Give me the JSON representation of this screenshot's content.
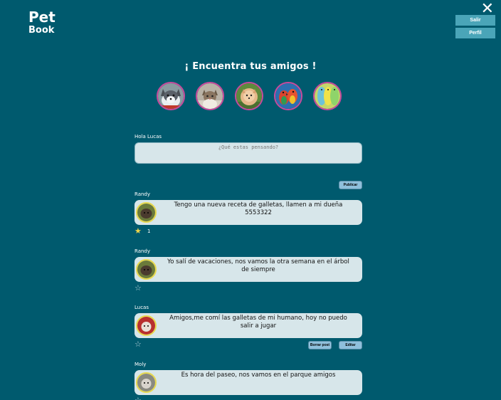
{
  "app": {
    "logo_line1": "Pet",
    "logo_line2": "Book"
  },
  "header": {
    "close_glyph": "✕",
    "logout_label": "Salir",
    "profile_label": "Perfil"
  },
  "friends": {
    "heading": "¡ Encuentra tus amigos !",
    "avatars": [
      "husky",
      "cat",
      "pomeranian",
      "parrot",
      "parakeet"
    ]
  },
  "composer": {
    "greeting": "Hola Lucas",
    "placeholder": "¿Qué estas pensando?",
    "publish_label": "Publicar"
  },
  "posts": [
    {
      "author": "Randy",
      "text": "Tengo una nueva receta de galletas, llamen a mi dueña 5553322",
      "liked": true,
      "likes": "1"
    },
    {
      "author": "Randy",
      "text": "Yo salí de vacaciones, nos vamos la otra semana en el árbol de siempre",
      "liked": false,
      "likes": ""
    },
    {
      "author": "Lucas",
      "text": "Amigos,me comí las galletas de mi humano, hoy no puedo salir a jugar",
      "liked": false,
      "likes": "",
      "delete_label": "Borrar post",
      "edit_label": "Editar"
    },
    {
      "author": "Moly",
      "text": "Es hora del paseo, nos vamos en el parque amigos",
      "liked": false,
      "likes": ""
    }
  ],
  "colors": {
    "background": "#005a6e",
    "button": "#4aa5b8",
    "card": "#d7e6ea",
    "avatar_ring": "#c94a9c",
    "post_avatar_ring": "#e8d94b"
  }
}
